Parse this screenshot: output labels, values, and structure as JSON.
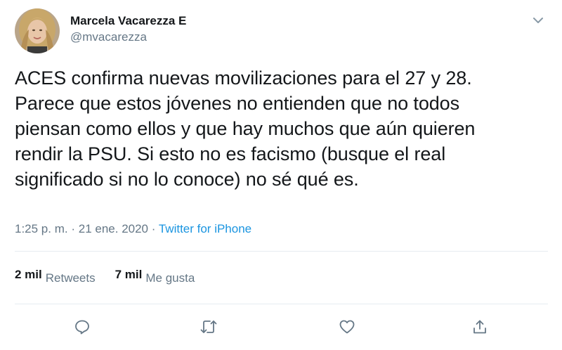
{
  "author": {
    "display_name": "Marcela Vacarezza E",
    "handle": "@mvacarezza"
  },
  "tweet": {
    "text": "ACES confirma nuevas movilizaciones para el 27 y 28.\nParece que estos jóvenes no entienden que no todos\npiensan como ellos y que hay muchos que aún quieren\nrendir la PSU. Si esto no es facismo (busque el real\nsignificado si no lo conoce) no sé qué es.",
    "time": "1:25 p. m.",
    "separator": "·",
    "date": "21 ene. 2020",
    "source": "Twitter for iPhone"
  },
  "stats": {
    "retweets_count": "2 mil",
    "retweets_label": "Retweets",
    "likes_count": "7 mil",
    "likes_label": "Me gusta"
  },
  "icons": {
    "menu": "chevron-down-icon",
    "reply": "reply-icon",
    "retweet": "retweet-icon",
    "like": "heart-icon",
    "share": "share-icon"
  },
  "colors": {
    "text_primary": "#14171a",
    "text_secondary": "#657786",
    "link": "#1b95e0",
    "divider": "#e6ecf0"
  }
}
